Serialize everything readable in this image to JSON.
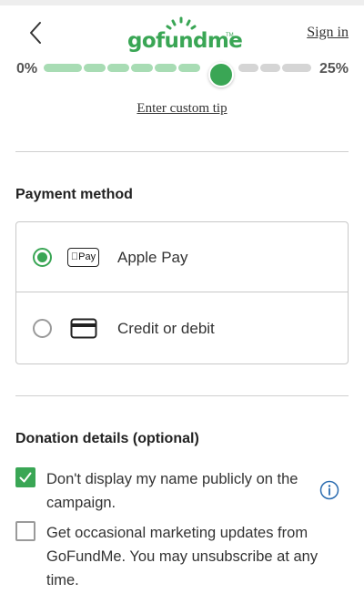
{
  "header": {
    "logo_text": "gofundme",
    "logo_tm": "TM",
    "signin_label": "Sign in",
    "back_icon": "chevron-left-icon"
  },
  "tip": {
    "min_label": "0%",
    "max_label": "25%",
    "custom_tip_label": "Enter custom tip",
    "colors": {
      "filled": "#a8dcb4",
      "empty": "#d5d5d5",
      "accent": "#3aa655"
    }
  },
  "payment": {
    "title": "Payment method",
    "options": [
      {
        "label": "Apple Pay",
        "badge": "Pay",
        "selected": true,
        "icon": "apple-pay-icon"
      },
      {
        "label": "Credit or debit",
        "selected": false,
        "icon": "credit-card-icon"
      }
    ]
  },
  "details": {
    "title": "Donation details (optional)",
    "checks": [
      {
        "line1": "Don't display my name publicly on the",
        "line2": "campaign.",
        "checked": true
      },
      {
        "line1": "Get occasional marketing updates from",
        "line2": "GoFundMe. You may unsubscribe at any",
        "line3": "time.",
        "checked": false
      }
    ],
    "info_icon": "info-icon"
  }
}
